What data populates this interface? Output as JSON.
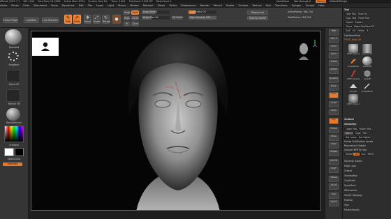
{
  "titlebar": {
    "items": [
      "ZBrush 2021.7.1",
      "GB: 1049",
      "Free Mem 15.93GB",
      "Active Mem 8734",
      "Scratch Disk 8%",
      "Timer 0.001",
      "PolyCount 0.003 MP",
      "MeshCount 1"
    ],
    "menus_right_label": "QuickSave",
    "see_through": "See-through 0",
    "menus_btn": "Menus",
    "default_script": "DefaultZScript"
  },
  "menubar": {
    "items": [
      "Alpha",
      "Brush",
      "Color",
      "Document",
      "Draw",
      "Dynamics",
      "Edit",
      "File",
      "Layer",
      "Light",
      "Macro",
      "Marker",
      "Material",
      "Movie",
      "Picker",
      "Preferences",
      "Render",
      "Stencil",
      "Stroke",
      "Surface",
      "Texture",
      "Tool",
      "Transform",
      "Zplugin",
      "Zscript",
      "Help"
    ]
  },
  "topshelf": {
    "home_page": "Home Page",
    "lightbox": "LightBox",
    "live_boolean": "Live Boolean",
    "edit": "Edit",
    "draw": "Draw",
    "move": "Move",
    "scale": "Scale",
    "rotate": "Rotate",
    "mrgb": "Mrgb",
    "rgb": "Rgb",
    "m": "M",
    "zadd": "Zadd",
    "zsub": "Zsub",
    "zcut": "Zcut",
    "focal_shift": "Focal Shift 0",
    "draw_size": "Draw Size 64",
    "dynamic": "Dynamic",
    "z_intensity": "Z Intensity 25",
    "rgb_intensity": "Rgb Intensity 100",
    "active_points": "ActivePoints: 164,744",
    "total_points": "TotalPoints: 164,744",
    "replay_last": "ReplayLast",
    "replay_last_rel": "ReplayLastRel"
  },
  "leftpanel": {
    "brush_label": "Standard",
    "stroke_label": "DragRect",
    "alpha_label": "Alpha Off",
    "texture_label": "Texture Off",
    "material_label": "BasicMaterial",
    "gradient_label": "Gradient",
    "switch_color": "SwitchColor",
    "alternate": "Alternate"
  },
  "viewport": {
    "reference_note": "",
    "bg_color": "#050505"
  },
  "rightstrip": {
    "buttons": [
      "BPR",
      "SPix 3",
      "Scroll",
      "Zoom",
      "Actual",
      "AAHalf",
      "Dynamic",
      "Persp",
      "Floor",
      "Local",
      "LSym",
      "Xyz",
      "Frame",
      "Move",
      "Scale",
      "Rotate",
      "Line Fill",
      "PolyF",
      "Transp",
      "Ghost",
      "Solo",
      "Xpose"
    ]
  },
  "rightpanel": {
    "tool_title": "Tool",
    "load_tool": "Load Tool",
    "save_as": "Save As",
    "copy_tool": "Copy Tool",
    "paste_tool": "Paste Tool",
    "import": "Import",
    "export": "Export",
    "clone": "Clone",
    "make_polymesh": "Make PolyMesh3D",
    "goz": "GoZ",
    "all": "All",
    "visible": "Visible",
    "r": "R",
    "lightbox_tools": "Lightbox▸Tools",
    "current_tool": "PM3D_Head 48",
    "tools": [
      "PM3D_Head 48",
      "Cylinder3D",
      "SimpleBrush",
      "Sphere3D",
      "PM3D_Cylinder3D",
      "Cube3D",
      "Plane3D",
      "SimpleBrush",
      "PM3D_Head_48"
    ],
    "subtool_section": "Subtool",
    "geometry": "Geometry",
    "lower_res": "Lower Res",
    "higher_res": "Higher Res",
    "sdiv": "SDiv 5",
    "cage": "Cage",
    "rstr": "Rstr",
    "del_lower": "Del Lower",
    "del_higher": "Del Higher",
    "freeze_subdiv": "Freeze SubDivision Levels",
    "reconstruct_subdiv": "Reconstruct Subdiv",
    "convert_bpr": "Convert BPR To Geo",
    "divide": "Divide",
    "smt": "Smt",
    "suv": "Suv",
    "reuv": "ReUV",
    "menu_items": [
      "Dynamic Subdiv",
      "Edge Loop",
      "Crease",
      "ShadowBox",
      "ClayPolish",
      "DynaMesh",
      "ZRemesher",
      "Modify Topology",
      "Position",
      "Size",
      "MeshIntegrity"
    ]
  },
  "colors": {
    "accent": "#e8792a",
    "panel": "#2d2d2d",
    "viewport_bg": "#050505"
  }
}
